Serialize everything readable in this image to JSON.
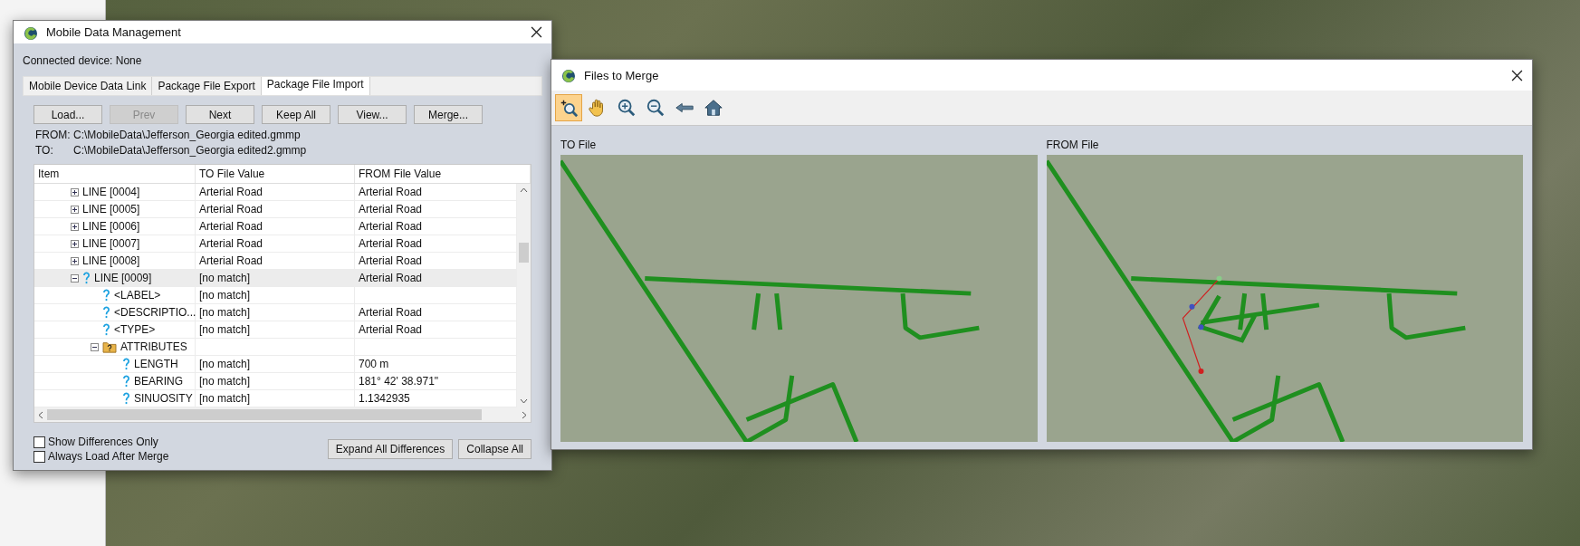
{
  "dialog": {
    "title": "Mobile Data Management",
    "connected": "Connected device: None",
    "tabs": [
      {
        "label": "Mobile Device Data Link",
        "selected": false
      },
      {
        "label": "Package File Export",
        "selected": false
      },
      {
        "label": "Package File Import",
        "selected": true
      }
    ],
    "buttons": [
      {
        "label": "Load...",
        "disabled": false
      },
      {
        "label": "Prev",
        "disabled": true
      },
      {
        "label": "Next",
        "disabled": false
      },
      {
        "label": "Keep All",
        "disabled": false
      },
      {
        "label": "View...",
        "disabled": false
      },
      {
        "label": "Merge...",
        "disabled": false
      }
    ],
    "paths": [
      {
        "label": "FROM:",
        "value": "C:\\MobileData\\Jefferson_Georgia edited.gmmp"
      },
      {
        "label": "TO:",
        "value": "C:\\MobileData\\Jefferson_Georgia edited2.gmmp"
      }
    ],
    "tree": {
      "columns": [
        "Item",
        "TO File Value",
        "FROM File Value"
      ],
      "items": [
        {
          "label": "LINE [0004]",
          "to": "Arterial Road",
          "from": "Arterial Road",
          "expanded": false,
          "unmatched": false,
          "selected": false
        },
        {
          "label": "LINE [0005]",
          "to": "Arterial Road",
          "from": "Arterial Road",
          "expanded": false,
          "unmatched": false,
          "selected": false
        },
        {
          "label": "LINE [0006]",
          "to": "Arterial Road",
          "from": "Arterial Road",
          "expanded": false,
          "unmatched": false,
          "selected": false
        },
        {
          "label": "LINE [0007]",
          "to": "Arterial Road",
          "from": "Arterial Road",
          "expanded": false,
          "unmatched": false,
          "selected": false
        },
        {
          "label": "LINE [0008]",
          "to": "Arterial Road",
          "from": "Arterial Road",
          "expanded": false,
          "unmatched": false,
          "selected": false
        },
        {
          "label": "LINE [0009]",
          "to": "[no match]",
          "from": "Arterial Road",
          "expanded": true,
          "unmatched": true,
          "selected": true,
          "children": [
            {
              "label": "<LABEL>",
              "to": "[no match]",
              "unmatched": true,
              "selected": false
            },
            {
              "label": "<DESCRIPTIO...",
              "to": "[no match]",
              "from": "Arterial Road",
              "unmatched": true,
              "selected": false
            },
            {
              "label": "<TYPE>",
              "to": "[no match]",
              "from": "Arterial Road",
              "unmatched": true,
              "selected": false
            },
            {
              "label": "ATTRIBUTES",
              "expanded": true,
              "unmatched": true,
              "selected": false,
              "children": [
                {
                  "label": "LENGTH",
                  "to": "[no match]",
                  "from": "700 m",
                  "unmatched": true,
                  "selected": false
                },
                {
                  "label": "BEARING",
                  "to": "[no match]",
                  "from": "181° 42' 38.971\"",
                  "unmatched": true,
                  "selected": false
                },
                {
                  "label": "SINUOSITY",
                  "to": "[no match]",
                  "from": "1.1342935",
                  "unmatched": true,
                  "selected": false
                }
              ]
            }
          ]
        }
      ]
    },
    "options": [
      {
        "label": "Show Differences Only",
        "checked": false
      },
      {
        "label": "Always Load After Merge",
        "checked": false
      }
    ],
    "footer_buttons": [
      "Expand All Differences",
      "Collapse All"
    ]
  },
  "merge_window": {
    "title": "Files to Merge",
    "toolbar": [
      {
        "kind": "zoom-box",
        "selected": true
      },
      {
        "kind": "pan",
        "selected": false
      },
      {
        "kind": "zoom-in",
        "selected": false
      },
      {
        "kind": "zoom-out",
        "selected": false
      },
      {
        "kind": "back",
        "selected": false
      },
      {
        "kind": "home",
        "selected": false
      }
    ],
    "maps": [
      {
        "label": "TO File",
        "kind": "to"
      },
      {
        "label": "FROM File",
        "kind": "from"
      }
    ]
  }
}
